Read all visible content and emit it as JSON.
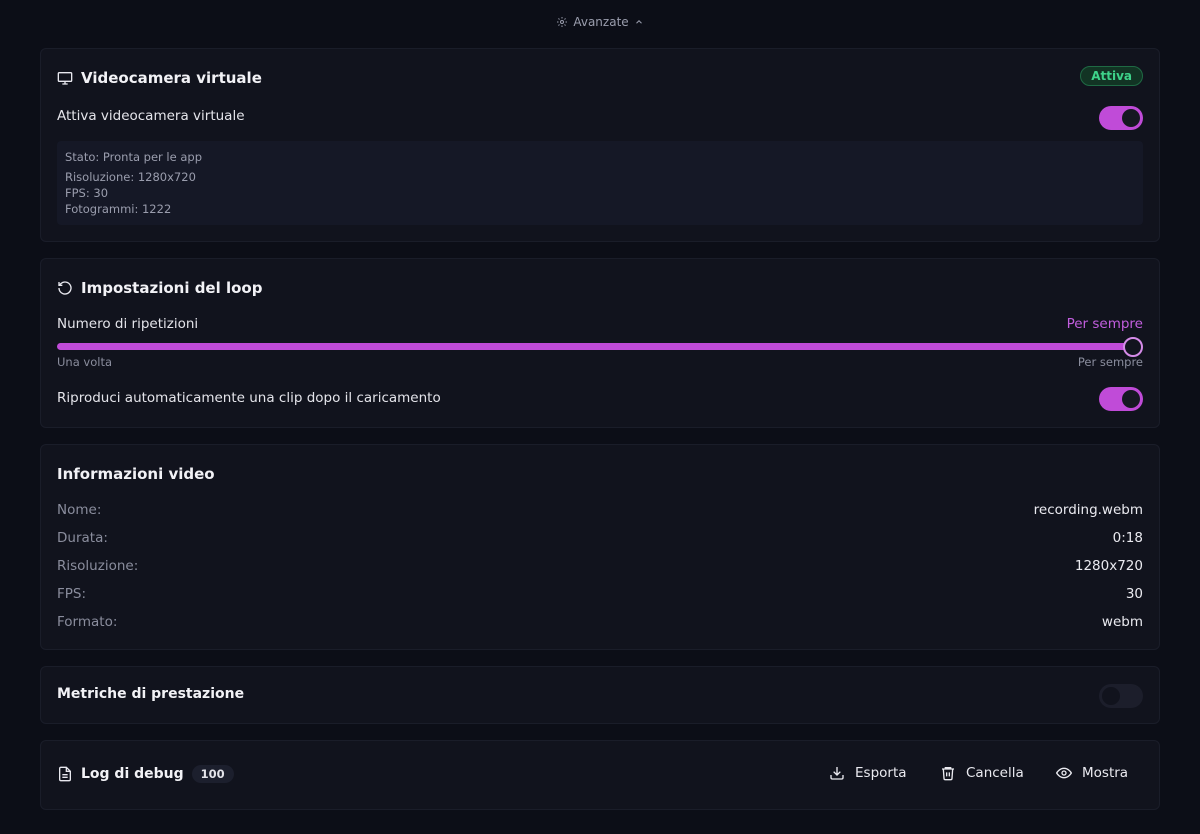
{
  "advanced": {
    "label": "Avanzate"
  },
  "virtual_camera": {
    "title": "Videocamera virtuale",
    "badge": "Attiva",
    "toggle_label": "Attiva videocamera virtuale",
    "toggle_on": true,
    "status": {
      "state": "Stato: Pronta per le app",
      "resolution": "Risoluzione: 1280x720",
      "fps": "FPS: 30",
      "frames": "Fotogrammi: 1222"
    }
  },
  "loop": {
    "title": "Impostazioni del loop",
    "repetitions_label": "Numero di ripetizioni",
    "repetitions_value": "Per sempre",
    "slider_min_label": "Una volta",
    "slider_max_label": "Per sempre",
    "slider_level": 1.0,
    "autoplay_label": "Riproduci automaticamente una clip dopo il caricamento",
    "autoplay_on": true
  },
  "video_info": {
    "title": "Informazioni video",
    "rows": [
      {
        "key": "Nome:",
        "value": "recording.webm"
      },
      {
        "key": "Durata:",
        "value": "0:18"
      },
      {
        "key": "Risoluzione:",
        "value": "1280x720"
      },
      {
        "key": "FPS:",
        "value": "30"
      },
      {
        "key": "Formato:",
        "value": "webm"
      }
    ]
  },
  "performance": {
    "title": "Metriche di prestazione",
    "toggle_on": false
  },
  "debug_log": {
    "title": "Log di debug",
    "count": "100",
    "export_label": "Esporta",
    "clear_label": "Cancella",
    "show_label": "Mostra"
  },
  "colors": {
    "accent": "#c04bd8",
    "background": "#0c0e17",
    "card": "#11131d",
    "success": "#3ed38a"
  },
  "icons": [
    "gear-icon",
    "chevron-up-icon",
    "monitor-icon",
    "rotate-ccw-icon",
    "file-text-icon",
    "download-icon",
    "trash-icon",
    "eye-icon"
  ]
}
